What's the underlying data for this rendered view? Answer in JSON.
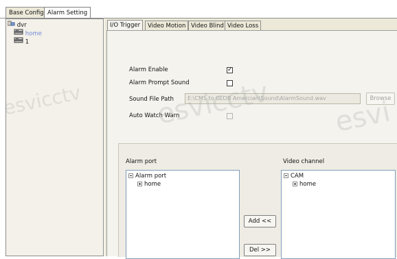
{
  "top_tabs": [
    {
      "label": "Base Config"
    },
    {
      "label": "Alarm Setting"
    }
  ],
  "tree": {
    "root": {
      "label": "dvr",
      "icon": "network-group-icon"
    },
    "children": [
      {
        "label": "home",
        "icon": "dvr-device-icon",
        "selected": true
      },
      {
        "label": "1",
        "icon": "dvr-device-icon",
        "selected": false
      }
    ]
  },
  "sub_tabs": [
    {
      "label": "I/O Trigger"
    },
    {
      "label": "Video Motion"
    },
    {
      "label": "Video Blind"
    },
    {
      "label": "Video Loss"
    }
  ],
  "io_trigger": {
    "alarm_enable": {
      "label": "Alarm Enable",
      "checked": "✓"
    },
    "alarm_prompt_sound": {
      "label": "Alarm Prompt Sound",
      "checked": ""
    },
    "sound_file_path": {
      "label": "Sound File Path",
      "value": "E:\\CMS to GLOB Amercian\\Sound\\AlarmSound.wav"
    },
    "browse_label": "Browse",
    "auto_watch_warn": {
      "label": "Auto Watch Warn",
      "checked": ""
    }
  },
  "alarm_port": {
    "title": "Alarm port",
    "items": [
      {
        "label": "Alarm port",
        "expanded": true
      },
      {
        "label": "home",
        "expanded": false
      }
    ]
  },
  "video_channel": {
    "title": "Video channel",
    "items": [
      {
        "label": "CAM",
        "expanded": true
      },
      {
        "label": "home",
        "expanded": false
      }
    ]
  },
  "buttons": {
    "add": "Add <<",
    "del": "Del >>"
  },
  "watermarks": [
    "esvicctv",
    "esvi",
    "esvicctv"
  ],
  "colors": {
    "selected_text": "#6f86d6",
    "panel_bg": "#ece9d8"
  }
}
